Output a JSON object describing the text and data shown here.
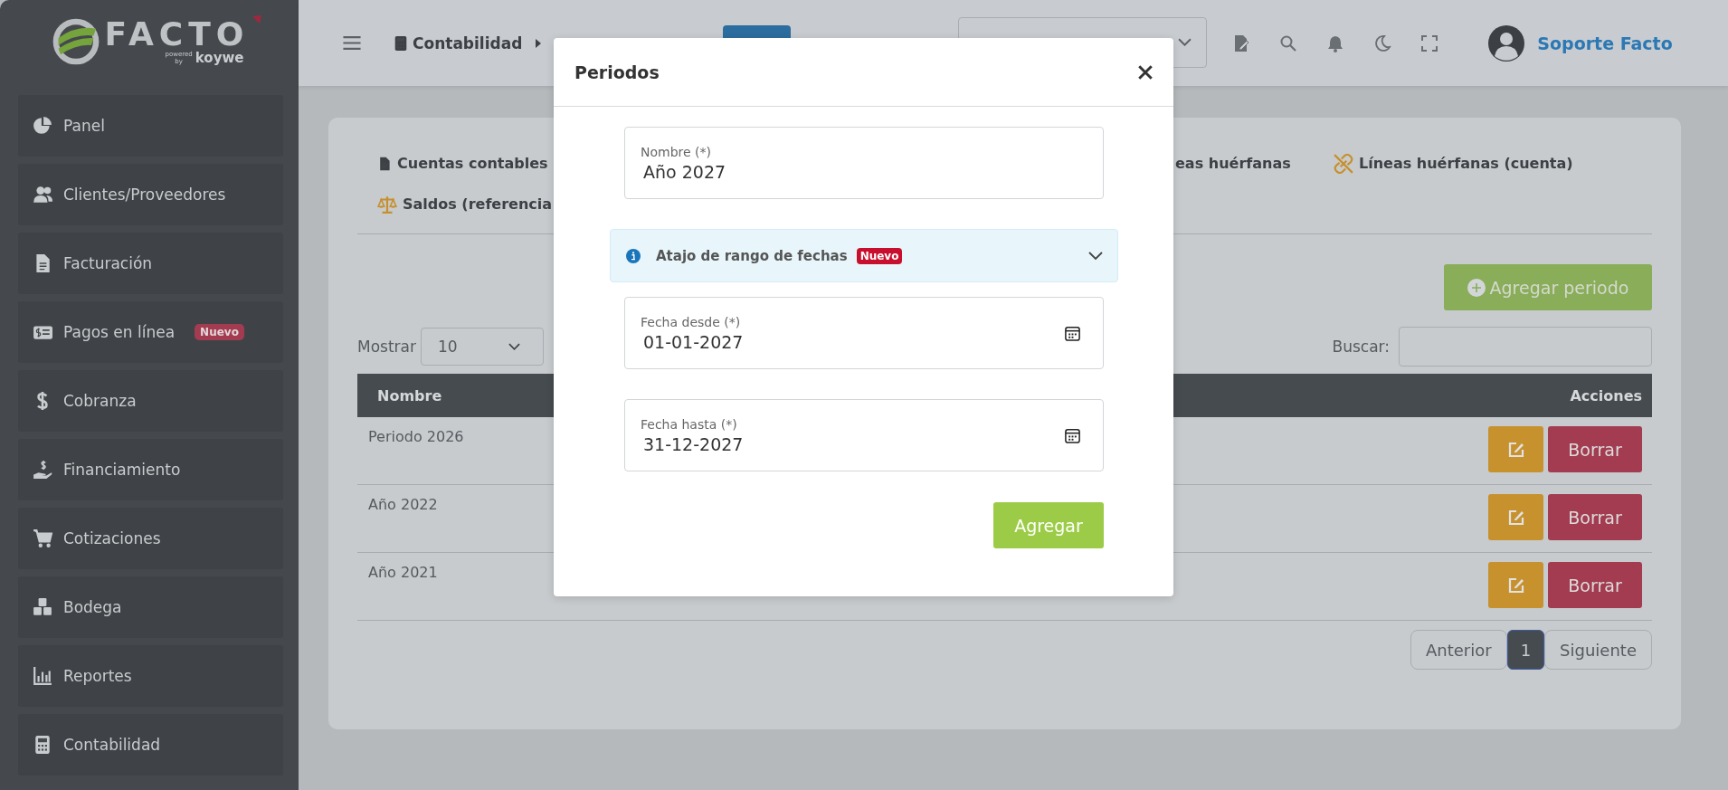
{
  "logo": {
    "brand": "FACTO",
    "powered": "powered",
    "by": "by",
    "partner": "koywe"
  },
  "sidebar": {
    "items": [
      {
        "label": "Panel",
        "kind": "panel"
      },
      {
        "label": "Clientes/Proveedores",
        "kind": "clients"
      },
      {
        "label": "Facturación",
        "kind": "billing"
      },
      {
        "label": "Pagos en línea",
        "kind": "payments",
        "badge": "Nuevo"
      },
      {
        "label": "Cobranza",
        "kind": "collection"
      },
      {
        "label": "Financiamiento",
        "kind": "financing"
      },
      {
        "label": "Cotizaciones",
        "kind": "quotes"
      },
      {
        "label": "Bodega",
        "kind": "warehouse"
      },
      {
        "label": "Reportes",
        "kind": "reports"
      },
      {
        "label": "Contabilidad",
        "kind": "accounting"
      }
    ]
  },
  "header": {
    "breadcrumb": "Contabilidad",
    "user": "Soporte Facto"
  },
  "tabs": [
    {
      "label": "Cuentas contables",
      "kind": "accounts"
    },
    {
      "label": "eas huérfanas",
      "kind": "cut"
    },
    {
      "label": "Líneas huérfanas (cuenta)",
      "kind": "orphans"
    },
    {
      "label": "Saldos (referencia",
      "kind": "balances"
    }
  ],
  "toolbar": {
    "add_button": "Agregar periodo",
    "show_label": "Mostrar",
    "page_size": "10",
    "search_label": "Buscar:"
  },
  "table": {
    "columns": [
      "Nombre",
      "Acciones"
    ],
    "rows": [
      {
        "name": "Periodo 2026",
        "delete": "Borrar"
      },
      {
        "name": "Año 2022",
        "delete": "Borrar"
      },
      {
        "name": "Año 2021",
        "delete": "Borrar"
      }
    ]
  },
  "pagination": {
    "previous": "Anterior",
    "pages": [
      {
        "label": "1",
        "selected": true
      }
    ],
    "next": "Siguiente"
  },
  "modal": {
    "title": "Periodos",
    "submit": "Agregar",
    "body": [
      {
        "kind": "text",
        "label": "Nombre (*)",
        "value": "Año 2027"
      },
      {
        "kind": "shortcut",
        "label": "Atajo de rango de fechas",
        "badge": "Nuevo",
        "expanded": false
      },
      {
        "kind": "date",
        "label": "Fecha desde (*)",
        "value": "01-01-2027"
      },
      {
        "kind": "date",
        "label": "Fecha hasta (*)",
        "value": "31-12-2027"
      }
    ]
  }
}
